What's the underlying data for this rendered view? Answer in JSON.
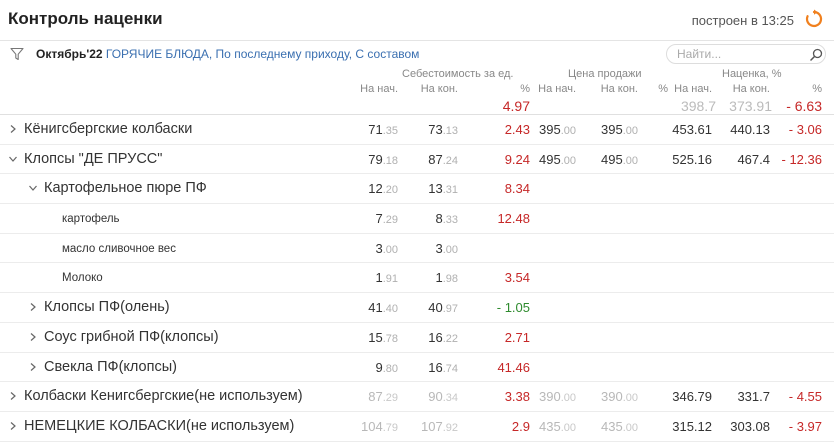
{
  "header": {
    "title": "Контроль наценки",
    "built": "построен в 13:25"
  },
  "filter": {
    "period": "Октябрь'22",
    "rest": "ГОРЯЧИЕ БЛЮДА, По последнему приходу, С составом",
    "search_placeholder": "Найти..."
  },
  "columns": {
    "groups": [
      "Себестоимость за ед.",
      "Цена продажи",
      "Наценка, %"
    ],
    "sub": [
      "На нач.",
      "На кон.",
      "%",
      "На нач.",
      "На кон.",
      "%",
      "На нач.",
      "На кон.",
      "%"
    ]
  },
  "totals": {
    "cost_pct": "4.97",
    "markup_start": "398.7",
    "markup_end": "373.91",
    "markup_pct": "- 6.63"
  },
  "rows": [
    {
      "name": "Кёнигсбергские колбаски",
      "level": 0,
      "toggle": "collapsed",
      "cost_start": [
        "71",
        ".35"
      ],
      "cost_end": [
        "73",
        ".13"
      ],
      "cost_pct": "2.43",
      "price_start": [
        "395",
        ".00"
      ],
      "price_end": [
        "395",
        ".00"
      ],
      "price_pct": "",
      "m_start": "453.61",
      "m_end": "440.13",
      "m_pct": "- 3.06",
      "muted": false
    },
    {
      "name": "Клопсы \"ДЕ ПРУСС\"",
      "level": 0,
      "toggle": "expanded",
      "cost_start": [
        "79",
        ".18"
      ],
      "cost_end": [
        "87",
        ".24"
      ],
      "cost_pct": "9.24",
      "price_start": [
        "495",
        ".00"
      ],
      "price_end": [
        "495",
        ".00"
      ],
      "price_pct": "",
      "m_start": "525.16",
      "m_end": "467.4",
      "m_pct": "- 12.36",
      "muted": false
    },
    {
      "name": "Картофельное пюре ПФ",
      "level": 1,
      "toggle": "expanded",
      "cost_start": [
        "12",
        ".20"
      ],
      "cost_end": [
        "13",
        ".31"
      ],
      "cost_pct": "8.34",
      "price_start": [
        "",
        ""
      ],
      "price_end": [
        "",
        ""
      ],
      "price_pct": "",
      "m_start": "",
      "m_end": "",
      "m_pct": "",
      "muted": false
    },
    {
      "name": "картофель",
      "level": 2,
      "toggle": "none",
      "cost_start": [
        "7",
        ".29"
      ],
      "cost_end": [
        "8",
        ".33"
      ],
      "cost_pct": "12.48",
      "price_start": [
        "",
        ""
      ],
      "price_end": [
        "",
        ""
      ],
      "price_pct": "",
      "m_start": "",
      "m_end": "",
      "m_pct": "",
      "muted": false
    },
    {
      "name": "масло сливочное вес",
      "level": 2,
      "toggle": "none",
      "cost_start": [
        "3",
        ".00"
      ],
      "cost_end": [
        "3",
        ".00"
      ],
      "cost_pct": "",
      "price_start": [
        "",
        ""
      ],
      "price_end": [
        "",
        ""
      ],
      "price_pct": "",
      "m_start": "",
      "m_end": "",
      "m_pct": "",
      "muted": false
    },
    {
      "name": "Молоко",
      "level": 2,
      "toggle": "none",
      "cost_start": [
        "1",
        ".91"
      ],
      "cost_end": [
        "1",
        ".98"
      ],
      "cost_pct": "3.54",
      "price_start": [
        "",
        ""
      ],
      "price_end": [
        "",
        ""
      ],
      "price_pct": "",
      "m_start": "",
      "m_end": "",
      "m_pct": "",
      "muted": false
    },
    {
      "name": "Клопсы ПФ(олень)",
      "level": 1,
      "toggle": "collapsed",
      "cost_start": [
        "41",
        ".40"
      ],
      "cost_end": [
        "40",
        ".97"
      ],
      "cost_pct": "- 1.05",
      "price_start": [
        "",
        ""
      ],
      "price_end": [
        "",
        ""
      ],
      "price_pct": "",
      "m_start": "",
      "m_end": "",
      "m_pct": "",
      "muted": false
    },
    {
      "name": "Соус грибной ПФ(клопсы)",
      "level": 1,
      "toggle": "collapsed",
      "cost_start": [
        "15",
        ".78"
      ],
      "cost_end": [
        "16",
        ".22"
      ],
      "cost_pct": "2.71",
      "price_start": [
        "",
        ""
      ],
      "price_end": [
        "",
        ""
      ],
      "price_pct": "",
      "m_start": "",
      "m_end": "",
      "m_pct": "",
      "muted": false
    },
    {
      "name": "Свекла ПФ(клопсы)",
      "level": 1,
      "toggle": "collapsed",
      "cost_start": [
        "9",
        ".80"
      ],
      "cost_end": [
        "16",
        ".74"
      ],
      "cost_pct": "41.46",
      "price_start": [
        "",
        ""
      ],
      "price_end": [
        "",
        ""
      ],
      "price_pct": "",
      "m_start": "",
      "m_end": "",
      "m_pct": "",
      "muted": false
    },
    {
      "name": "Колбаски Кенигсбергские(не используем)",
      "level": 0,
      "toggle": "collapsed",
      "cost_start": [
        "87",
        ".29"
      ],
      "cost_end": [
        "90",
        ".34"
      ],
      "cost_pct": "3.38",
      "price_start": [
        "390",
        ".00"
      ],
      "price_end": [
        "390",
        ".00"
      ],
      "price_pct": "",
      "m_start": "346.79",
      "m_end": "331.7",
      "m_pct": "- 4.55",
      "muted": true
    },
    {
      "name": "НЕМЕЦКИЕ КОЛБАСКИ(не используем)",
      "level": 0,
      "toggle": "collapsed",
      "cost_start": [
        "104",
        ".79"
      ],
      "cost_end": [
        "107",
        ".92"
      ],
      "cost_pct": "2.9",
      "price_start": [
        "435",
        ".00"
      ],
      "price_end": [
        "435",
        ".00"
      ],
      "price_pct": "",
      "m_start": "315.12",
      "m_end": "303.08",
      "m_pct": "- 3.97",
      "muted": true
    }
  ],
  "colors": {
    "accent_orange": "#f0801e",
    "negative": "#c62828",
    "positive": "#2e8b2e",
    "link_blue": "#3a6fb0"
  },
  "icons": {
    "refresh": "refresh-icon",
    "filter": "funnel-icon",
    "search": "search-icon"
  }
}
